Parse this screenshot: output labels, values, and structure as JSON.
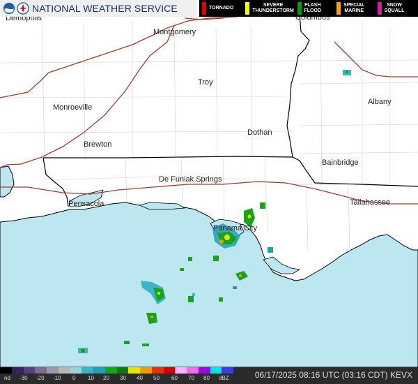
{
  "header": {
    "title": "NATIONAL WEATHER SERVICE"
  },
  "legend": [
    {
      "label": "TORNADO",
      "color": "#e00000"
    },
    {
      "label": "SEVERE\nTHUNDERSTORM",
      "color": "#ffff00"
    },
    {
      "label": "FLASH\nFLOOD",
      "color": "#00a000"
    },
    {
      "label": "SPECIAL\nMARINE",
      "color": "#ffa000"
    },
    {
      "label": "SNOW\nSQUALL",
      "color": "#d020a0"
    }
  ],
  "cities": {
    "demopolis": "Demopolis",
    "montgomery": "Montgomery",
    "columbus": "Columbus",
    "troy": "Troy",
    "monroeville": "Monroeville",
    "albany": "Albany",
    "dothan": "Dothan",
    "brewton": "Brewton",
    "bainbridge": "Bainbridge",
    "defuniak": "De Funiak Springs",
    "pensacola": "Pensacola",
    "tallahassee": "Tallahassee",
    "panamacity": "Panama City"
  },
  "scale": {
    "ticks": [
      "nd",
      "-30",
      "-20",
      "-10",
      "0",
      "10",
      "20",
      "30",
      "40",
      "50",
      "60",
      "70",
      "80",
      "dBZ"
    ],
    "colors": [
      "#000000",
      "#3a1f5f",
      "#5a3f7f",
      "#7a6f8f",
      "#9a9aa4",
      "#b8bcb0",
      "#9ed4d4",
      "#3cb4c8",
      "#1fa0b4",
      "#19a319",
      "#0e7a0e",
      "#e6e600",
      "#e6a000",
      "#e63200",
      "#d20000",
      "#ffb4ff",
      "#f06ef0",
      "#a000e6",
      "#00e6e6",
      "#3c3cdc"
    ]
  },
  "timestamp": "06/17/2025 08:16 UTC (03:16 CDT) KEVX",
  "colors": {
    "water": "#bde7f0",
    "land": "#ffffff",
    "interstate": "#a83a2a",
    "border": "#000000",
    "county": "#cfcfcf"
  }
}
